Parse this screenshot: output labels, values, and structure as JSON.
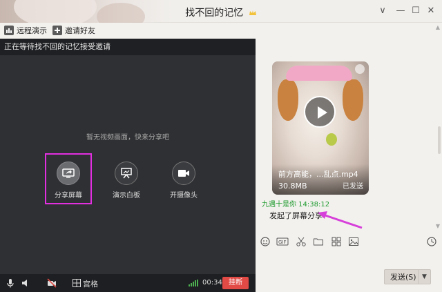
{
  "window": {
    "title": "找不回的记忆"
  },
  "window_controls": {
    "menu": "∨",
    "minimize": "—",
    "maximize": "☐",
    "close": "✕"
  },
  "toolbar": {
    "remote_demo": "远程演示",
    "invite_friends": "邀请好友"
  },
  "video": {
    "waiting_text": "正在等待找不回的记忆接受邀请",
    "no_video_text": "暂无视频画面，快来分享吧",
    "actions": [
      {
        "label": "分享屏幕",
        "icon": "share-screen-icon"
      },
      {
        "label": "演示白板",
        "icon": "whiteboard-icon"
      },
      {
        "label": "开摄像头",
        "icon": "camera-icon"
      }
    ]
  },
  "bottombar": {
    "grid_label": "宫格",
    "timer": "00:34",
    "hangup_label": "挂断"
  },
  "chat": {
    "video_card": {
      "file_name": "前方高能，...乱点.mp4",
      "file_size": "30.8MB",
      "status": "已发送"
    },
    "sender": "九遇十是你  14:38:12",
    "system_message": "发起了屏幕分享",
    "send_label": "发送(S)"
  },
  "colors": {
    "accent_green": "#1c9a2c",
    "hangup_red": "#e14a45",
    "highlight_magenta": "#e22fe0",
    "arrow_magenta": "#d63fd9"
  }
}
